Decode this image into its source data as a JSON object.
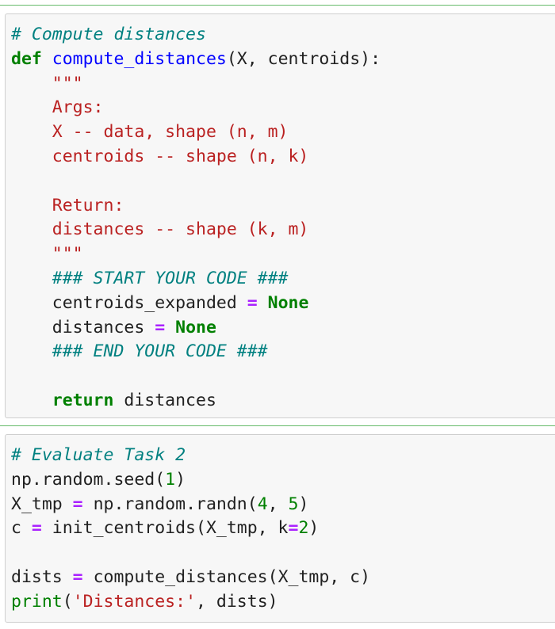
{
  "cells": [
    {
      "id": "cell-compute-distances",
      "lines": [
        [
          {
            "t": "cm",
            "v": "# Compute distances"
          }
        ],
        [
          {
            "t": "kw",
            "v": "def"
          },
          {
            "t": "",
            "v": " "
          },
          {
            "t": "fn",
            "v": "compute_distances"
          },
          {
            "t": "",
            "v": "(X, centroids):"
          }
        ],
        [
          {
            "t": "",
            "v": "    "
          },
          {
            "t": "st",
            "v": "\"\"\""
          }
        ],
        [
          {
            "t": "st",
            "v": "    Args:"
          }
        ],
        [
          {
            "t": "st",
            "v": "    X -- data, shape (n, m)"
          }
        ],
        [
          {
            "t": "st",
            "v": "    centroids -- shape (n, k)"
          }
        ],
        [
          {
            "t": "",
            "v": ""
          }
        ],
        [
          {
            "t": "st",
            "v": "    Return:"
          }
        ],
        [
          {
            "t": "st",
            "v": "    distances -- shape (k, m)"
          }
        ],
        [
          {
            "t": "st",
            "v": "    \"\"\""
          }
        ],
        [
          {
            "t": "",
            "v": "    "
          },
          {
            "t": "cm",
            "v": "### START YOUR CODE ###"
          }
        ],
        [
          {
            "t": "",
            "v": "    centroids_expanded "
          },
          {
            "t": "op",
            "v": "="
          },
          {
            "t": "",
            "v": " "
          },
          {
            "t": "kw",
            "v": "None"
          }
        ],
        [
          {
            "t": "",
            "v": "    distances "
          },
          {
            "t": "op",
            "v": "="
          },
          {
            "t": "",
            "v": " "
          },
          {
            "t": "kw",
            "v": "None"
          }
        ],
        [
          {
            "t": "",
            "v": "    "
          },
          {
            "t": "cm",
            "v": "### END YOUR CODE ###"
          }
        ],
        [
          {
            "t": "",
            "v": ""
          }
        ],
        [
          {
            "t": "",
            "v": "    "
          },
          {
            "t": "kw",
            "v": "return"
          },
          {
            "t": "",
            "v": " distances"
          }
        ]
      ]
    },
    {
      "id": "cell-evaluate-task-2",
      "lines": [
        [
          {
            "t": "cm",
            "v": "# Evaluate Task 2"
          }
        ],
        [
          {
            "t": "",
            "v": "np.random.seed("
          },
          {
            "t": "nm",
            "v": "1"
          },
          {
            "t": "",
            "v": ")"
          }
        ],
        [
          {
            "t": "",
            "v": "X_tmp "
          },
          {
            "t": "op",
            "v": "="
          },
          {
            "t": "",
            "v": " np.random.randn("
          },
          {
            "t": "nm",
            "v": "4"
          },
          {
            "t": "",
            "v": ", "
          },
          {
            "t": "nm",
            "v": "5"
          },
          {
            "t": "",
            "v": ")"
          }
        ],
        [
          {
            "t": "",
            "v": "c "
          },
          {
            "t": "op",
            "v": "="
          },
          {
            "t": "",
            "v": " init_centroids(X_tmp, k"
          },
          {
            "t": "op",
            "v": "="
          },
          {
            "t": "nm",
            "v": "2"
          },
          {
            "t": "",
            "v": ")"
          }
        ],
        [
          {
            "t": "",
            "v": ""
          }
        ],
        [
          {
            "t": "",
            "v": "dists "
          },
          {
            "t": "op",
            "v": "="
          },
          {
            "t": "",
            "v": " compute_distances(X_tmp, c)"
          }
        ],
        [
          {
            "t": "bi",
            "v": "print"
          },
          {
            "t": "",
            "v": "("
          },
          {
            "t": "st",
            "v": "'Distances:'"
          },
          {
            "t": "",
            "v": ", dists)"
          }
        ]
      ]
    }
  ]
}
